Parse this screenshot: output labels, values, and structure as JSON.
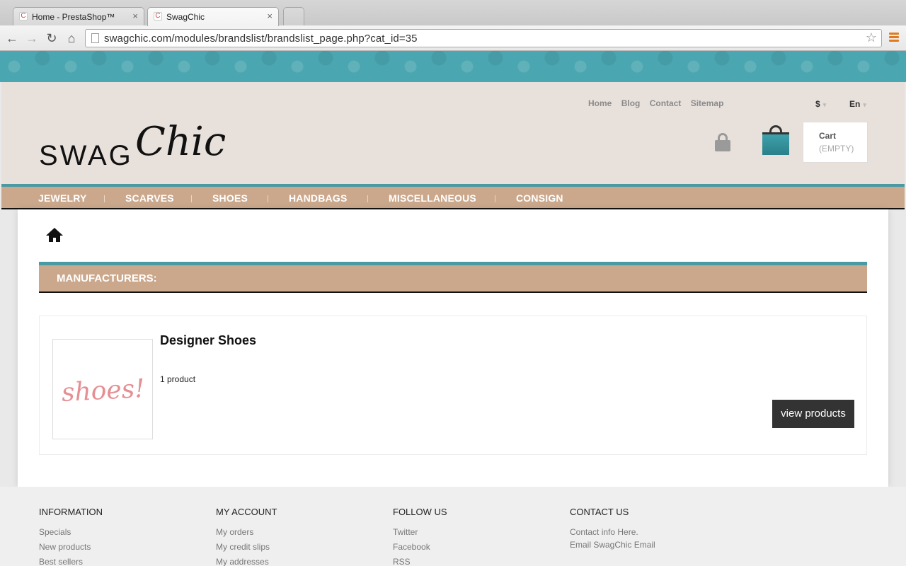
{
  "browser": {
    "tabs": [
      {
        "title": "Home - PrestaShop™",
        "active": false
      },
      {
        "title": "SwagChic",
        "active": true
      }
    ],
    "url": "swagchic.com/modules/brandslist/brandslist_page.php?cat_id=35",
    "back_icon": "←",
    "forward_icon": "→",
    "reload_icon": "↻",
    "home_icon": "⌂",
    "star_icon": "☆",
    "close_icon": "×"
  },
  "header": {
    "logo_swag": "SWAG",
    "logo_chic": "Chic",
    "links": [
      "Home",
      "Blog",
      "Contact",
      "Sitemap"
    ],
    "currency": "$",
    "language": "En",
    "cart_label": "Cart",
    "cart_status": "(EMPTY)"
  },
  "nav": {
    "items": [
      "JEWELRY",
      "SCARVES",
      "SHOES",
      "HANDBAGS",
      "MISCELLANEOUS",
      "CONSIGN"
    ]
  },
  "content": {
    "section_title": "MANUFACTURERS:",
    "brand": {
      "name": "Designer Shoes",
      "count": "1 product",
      "thumb_text": "shoes!",
      "button": "view products"
    }
  },
  "footer": {
    "columns": [
      {
        "title": "INFORMATION",
        "links": [
          "Specials",
          "New products",
          "Best sellers"
        ]
      },
      {
        "title": "MY ACCOUNT",
        "links": [
          "My orders",
          "My credit slips",
          "My addresses"
        ]
      },
      {
        "title": "FOLLOW US",
        "links": [
          "Twitter",
          "Facebook",
          "RSS"
        ]
      },
      {
        "title": "CONTACT US",
        "links": [
          "Contact info Here.",
          "Email SwagChic Email"
        ]
      }
    ]
  },
  "colors": {
    "teal": "#4a9aa3",
    "tan": "#cba88c",
    "header_bg": "#e8e0db"
  }
}
